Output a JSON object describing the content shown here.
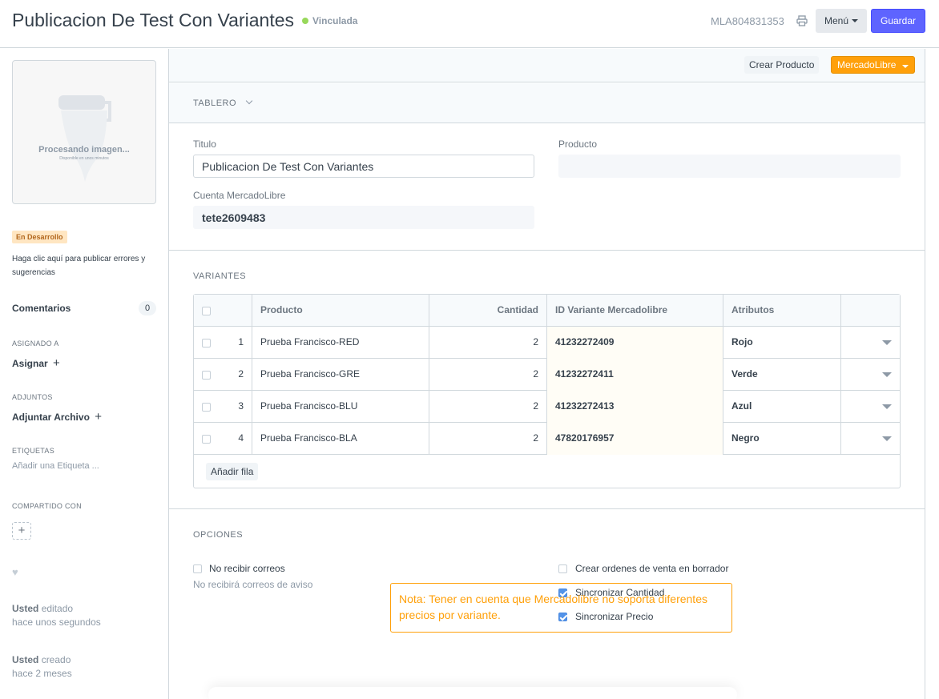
{
  "header": {
    "title": "Publicacion De Test Con Variantes",
    "status": "Vinculada",
    "doc_id": "MLA804831353",
    "menu_label": "Menú",
    "save_label": "Guardar",
    "status_color": "#98d85b",
    "accent": "#5e64ff"
  },
  "sidebar": {
    "image_text": "Procesando imagen...",
    "image_subtext": "Disponible en unos minutos",
    "badge": "En Desarrollo",
    "help_text": "Haga clic aquí para publicar errores y sugerencias",
    "comments_label": "Comentarios",
    "comments_count": "0",
    "assigned_label": "ASIGNADO A",
    "assign_action": "Asignar",
    "attachments_label": "ADJUNTOS",
    "attach_action": "Adjuntar Archivo",
    "tags_label": "ETIQUETAS",
    "tags_placeholder": "Añadir una Etiqueta ...",
    "shared_label": "COMPARTIDO CON",
    "activity": [
      {
        "user": "Usted",
        "action": "editado",
        "time": "hace unos segundos"
      },
      {
        "user": "Usted",
        "action": "creado",
        "time": "hace 2 meses"
      }
    ]
  },
  "toolbar": {
    "crear_producto": "Crear Producto",
    "mercadolibre": "MercadoLibre",
    "meli_color": "#ffa00a"
  },
  "tablero": {
    "label": "TABLERO"
  },
  "form": {
    "titulo_label": "Titulo",
    "titulo_value": "Publicacion De Test Con Variantes",
    "producto_label": "Producto",
    "producto_value": "",
    "cuenta_label": "Cuenta MercadoLibre",
    "cuenta_value": "tete2609483"
  },
  "variantes": {
    "label": "VARIANTES",
    "columns": [
      "Producto",
      "Cantidad",
      "ID Variante Mercadolibre",
      "Atributos"
    ],
    "rows": [
      {
        "idx": "1",
        "producto": "Prueba Francisco-RED",
        "cantidad": "2",
        "id_variante": "41232272409",
        "atributos": "Rojo"
      },
      {
        "idx": "2",
        "producto": "Prueba Francisco-GRE",
        "cantidad": "2",
        "id_variante": "41232272411",
        "atributos": "Verde"
      },
      {
        "idx": "3",
        "producto": "Prueba Francisco-BLU",
        "cantidad": "2",
        "id_variante": "41232272413",
        "atributos": "Azul"
      },
      {
        "idx": "4",
        "producto": "Prueba Francisco-BLA",
        "cantidad": "2",
        "id_variante": "47820176957",
        "atributos": "Negro"
      }
    ],
    "add_row": "Añadir fila"
  },
  "opciones": {
    "label": "OPCIONES",
    "no_recibir_correos": "No recibir correos",
    "no_recibir_desc": "No recibirá correos de aviso",
    "crear_ordenes": "Crear ordenes de venta en borrador",
    "sincronizar_cantidad": "Sincronizar Cantidad",
    "sincronizar_precio": "Sincronizar Precio",
    "note": "Nota: Tener en cuenta que Mercadolibre no soporta diferentes precios por variante."
  }
}
